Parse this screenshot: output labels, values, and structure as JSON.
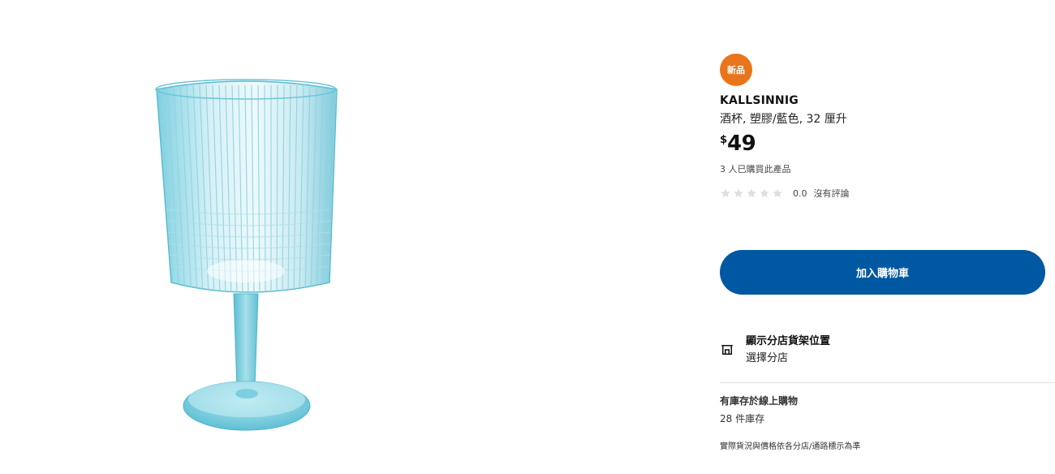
{
  "badge": {
    "label": "新品"
  },
  "product": {
    "name": "KALLSINNIG",
    "description": "酒杯, 塑膠/藍色, 32 厘升",
    "price": {
      "currency": "$",
      "amount": "49"
    },
    "purchased_text": "3 人已購買此產品",
    "rating": {
      "stars": 0,
      "max_stars": 5,
      "value": "0.0",
      "text": "沒有評論"
    }
  },
  "actions": {
    "add_to_cart": "加入購物車"
  },
  "store": {
    "title": "顯示分店貨架位置",
    "subtitle": "選擇分店"
  },
  "online": {
    "title": "有庫存於線上購物",
    "stock": "28 件庫存"
  },
  "disclaimer": "實際貨況與價格依各分店/通路標示為準",
  "colors": {
    "badge": "#e8751a",
    "button": "#0058a3",
    "glass": "#6cc9dc"
  },
  "icons": {
    "store": "store-shelf-icon",
    "star": "star-icon"
  }
}
